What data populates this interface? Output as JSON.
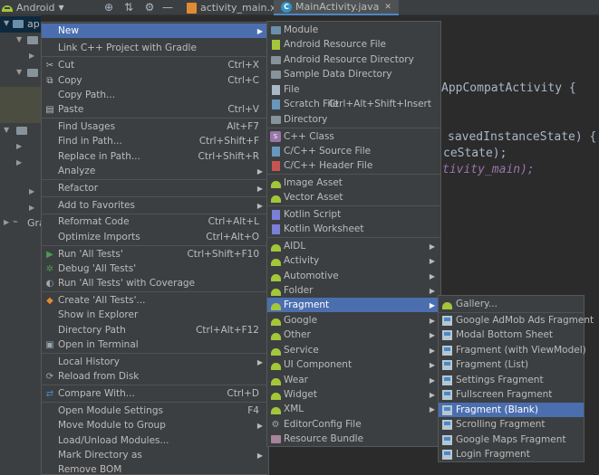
{
  "project_view": "Android",
  "editor": {
    "tabs": [
      {
        "label": "activity_main.xml"
      },
      {
        "label": "MainActivity.java"
      }
    ],
    "code_lines": [
      "AppCompatActivity {",
      "savedInstanceState) {",
      "ceState);",
      "tivity_main);"
    ]
  },
  "sidebar": {
    "item_app": "ap",
    "item_gradle": "Gra"
  },
  "context_menu": {
    "items": [
      {
        "label": "New"
      },
      {
        "label": "Link C++ Project with Gradle"
      },
      {
        "label": "Cut",
        "shortcut": "Ctrl+X"
      },
      {
        "label": "Copy",
        "shortcut": "Ctrl+C"
      },
      {
        "label": "Copy Path..."
      },
      {
        "label": "Paste",
        "shortcut": "Ctrl+V"
      },
      {
        "label": "Find Usages",
        "shortcut": "Alt+F7"
      },
      {
        "label": "Find in Path...",
        "shortcut": "Ctrl+Shift+F"
      },
      {
        "label": "Replace in Path...",
        "shortcut": "Ctrl+Shift+R"
      },
      {
        "label": "Analyze"
      },
      {
        "label": "Refactor"
      },
      {
        "label": "Add to Favorites"
      },
      {
        "label": "Reformat Code",
        "shortcut": "Ctrl+Alt+L"
      },
      {
        "label": "Optimize Imports",
        "shortcut": "Ctrl+Alt+O"
      },
      {
        "label": "Run 'All Tests'",
        "shortcut": "Ctrl+Shift+F10"
      },
      {
        "label": "Debug 'All Tests'"
      },
      {
        "label": "Run 'All Tests' with Coverage"
      },
      {
        "label": "Create 'All Tests'..."
      },
      {
        "label": "Show in Explorer"
      },
      {
        "label": "Directory Path",
        "shortcut": "Ctrl+Alt+F12"
      },
      {
        "label": "Open in Terminal"
      },
      {
        "label": "Local History"
      },
      {
        "label": "Reload from Disk"
      },
      {
        "label": "Compare With...",
        "shortcut": "Ctrl+D"
      },
      {
        "label": "Open Module Settings",
        "shortcut": "F4"
      },
      {
        "label": "Move Module to Group"
      },
      {
        "label": "Load/Unload Modules..."
      },
      {
        "label": "Mark Directory as"
      },
      {
        "label": "Remove BOM"
      }
    ]
  },
  "new_menu": {
    "items": [
      {
        "label": "Module"
      },
      {
        "label": "Android Resource File"
      },
      {
        "label": "Android Resource Directory"
      },
      {
        "label": "Sample Data Directory"
      },
      {
        "label": "File"
      },
      {
        "label": "Scratch File",
        "shortcut": "Ctrl+Alt+Shift+Insert"
      },
      {
        "label": "Directory"
      },
      {
        "label": "C++ Class"
      },
      {
        "label": "C/C++ Source File"
      },
      {
        "label": "C/C++ Header File"
      },
      {
        "label": "Image Asset"
      },
      {
        "label": "Vector Asset"
      },
      {
        "label": "Kotlin Script"
      },
      {
        "label": "Kotlin Worksheet"
      },
      {
        "label": "AIDL"
      },
      {
        "label": "Activity"
      },
      {
        "label": "Automotive"
      },
      {
        "label": "Folder"
      },
      {
        "label": "Fragment"
      },
      {
        "label": "Google"
      },
      {
        "label": "Other"
      },
      {
        "label": "Service"
      },
      {
        "label": "UI Component"
      },
      {
        "label": "Wear"
      },
      {
        "label": "Widget"
      },
      {
        "label": "XML"
      },
      {
        "label": "EditorConfig File"
      },
      {
        "label": "Resource Bundle"
      }
    ]
  },
  "fragment_menu": {
    "items": [
      {
        "label": "Gallery..."
      },
      {
        "label": "Google AdMob Ads Fragment"
      },
      {
        "label": "Modal Bottom Sheet"
      },
      {
        "label": "Fragment (with ViewModel)"
      },
      {
        "label": "Fragment (List)"
      },
      {
        "label": "Settings Fragment"
      },
      {
        "label": "Fullscreen Fragment"
      },
      {
        "label": "Fragment (Blank)"
      },
      {
        "label": "Scrolling Fragment"
      },
      {
        "label": "Google Maps Fragment"
      },
      {
        "label": "Login Fragment"
      }
    ]
  },
  "colors": {
    "menu_bg": "#3c3f41",
    "highlight": "#4b6eaf",
    "editor_bg": "#2b2b2b",
    "android_green": "#a4c639"
  }
}
